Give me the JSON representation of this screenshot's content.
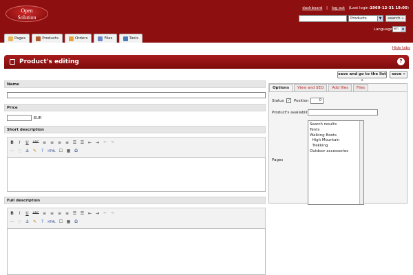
{
  "header": {
    "logo": {
      "line1": "Open",
      "line2": "Solution"
    },
    "dashboard": "dashboard",
    "sep": "|",
    "logout": "log out",
    "last_login_label": "(Last login:",
    "last_login_value": "1969-12-31 19:00",
    ")": ")",
    "search_value": "",
    "search_type": "Products",
    "search_button": "search »",
    "language_label": "Language",
    "language_value": "en"
  },
  "nav": {
    "tabs": [
      {
        "label": "Pages"
      },
      {
        "label": "Products"
      },
      {
        "label": "Orders"
      },
      {
        "label": "Files"
      },
      {
        "label": "Tools"
      }
    ]
  },
  "hide_tabs": "Hide tabs",
  "page": {
    "title": "Product's editing"
  },
  "actions": {
    "save_go": "save and go to the list »",
    "save": "save »"
  },
  "form": {
    "name_label": "Name",
    "name_value": "",
    "price_label": "Price",
    "price_value": "",
    "price_currency": "EUR",
    "short_label": "Short description",
    "full_label": "Full description",
    "toolbar1": [
      "B",
      "I",
      "U",
      "ABC",
      "≡",
      "≡",
      "≡",
      "≡",
      "☰",
      "☰",
      "⇤",
      "⇥",
      "↶",
      "↷"
    ],
    "toolbar2": [
      "—",
      "◌",
      "⚓",
      "✎",
      "?",
      "HTML",
      "☐",
      "▦",
      "Ω"
    ]
  },
  "right": {
    "tabs": [
      {
        "label": "Options"
      },
      {
        "label": "View and SEO"
      },
      {
        "label": "Add files"
      },
      {
        "label": "Files"
      }
    ],
    "status_label": "Status",
    "status_checked": true,
    "position_label": "Position",
    "position_value": "0",
    "availability_label": "Product's availability",
    "availability_value": "",
    "pages_label": "Pages",
    "pages": [
      "Search results",
      "Tents",
      "Walking Boots",
      "  High Mountain",
      "  Trekking",
      "Outdoor accessories"
    ]
  },
  "colors": {
    "header": "#8e0f0f",
    "title": "#a81c1c",
    "link": "#c02020"
  }
}
